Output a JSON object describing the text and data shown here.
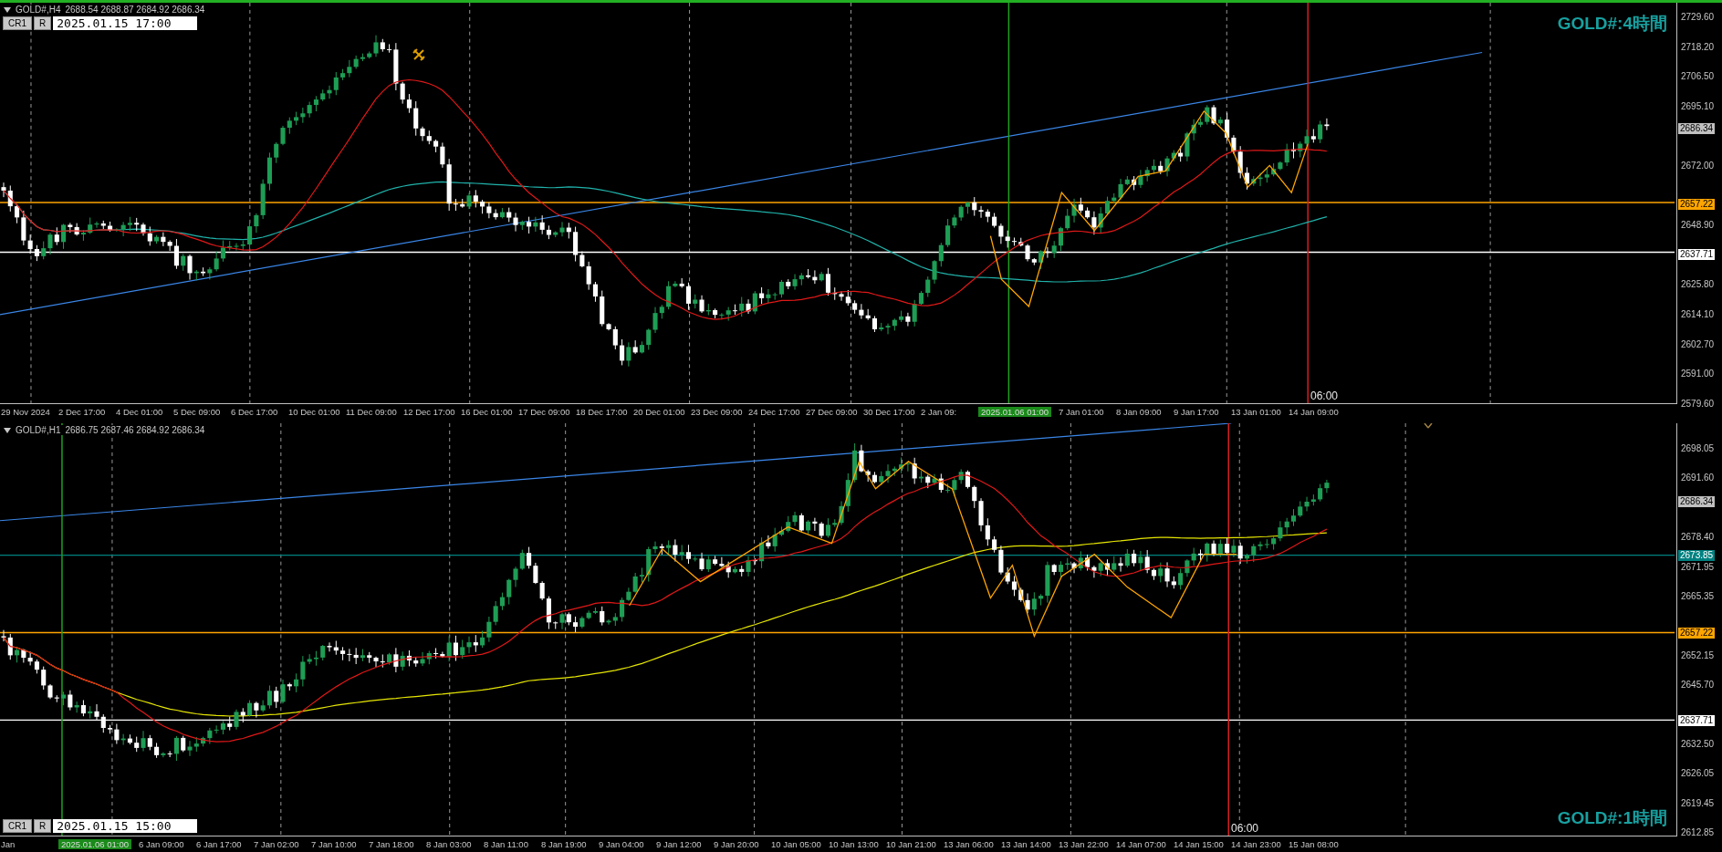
{
  "panels": [
    {
      "symbol": "GOLD#,H4",
      "ohlc": "2688.54 2688.87 2684.92 2686.34",
      "buttons": [
        "CR1",
        "R"
      ],
      "date_field": "2025.01.15 17:00",
      "title": "GOLD#:4時間",
      "cursor_time": "06:00",
      "price_ticks": [
        "2729.60",
        "2718.20",
        "2706.50",
        "2695.10",
        "2672.00",
        "2648.90",
        "2625.80",
        "2614.10",
        "2602.70",
        "2591.00",
        "2579.60"
      ],
      "price_markers": [
        {
          "text": "2686.34",
          "kind": "bid",
          "color": "#c0c0c0"
        },
        {
          "text": "2657.22",
          "kind": "line",
          "color": "#ffa500"
        },
        {
          "text": "2637.71",
          "kind": "line",
          "color": "#ffffff"
        }
      ],
      "time_labels": [
        {
          "text": "29 Nov 2024",
          "kind": "tick"
        },
        {
          "text": "2 Dec 17:00",
          "kind": "tick"
        },
        {
          "text": "4 Dec 01:00",
          "kind": "tick"
        },
        {
          "text": "5 Dec 09:00",
          "kind": "tick"
        },
        {
          "text": "6 Dec 17:00",
          "kind": "tick"
        },
        {
          "text": "10 Dec 01:00",
          "kind": "tick"
        },
        {
          "text": "11 Dec 09:00",
          "kind": "tick"
        },
        {
          "text": "12 Dec 17:00",
          "kind": "tick"
        },
        {
          "text": "16 Dec 01:00",
          "kind": "tick"
        },
        {
          "text": "17 Dec 09:00",
          "kind": "tick"
        },
        {
          "text": "18 Dec 17:00",
          "kind": "tick"
        },
        {
          "text": "20 Dec 01:00",
          "kind": "tick"
        },
        {
          "text": "23 Dec 09:00",
          "kind": "tick"
        },
        {
          "text": "24 Dec 17:00",
          "kind": "tick"
        },
        {
          "text": "27 Dec 09:00",
          "kind": "tick"
        },
        {
          "text": "30 Dec 17:00",
          "kind": "tick"
        },
        {
          "text": "2 Jan 09:",
          "kind": "tick"
        },
        {
          "text": "2025.01.06 01:00",
          "kind": "highlight"
        },
        {
          "text": "7 Jan 01:00",
          "kind": "tick"
        },
        {
          "text": "8 Jan 09:00",
          "kind": "tick"
        },
        {
          "text": "9 Jan 17:00",
          "kind": "tick"
        },
        {
          "text": "13 Jan 01:00",
          "kind": "tick"
        },
        {
          "text": "14 Jan 09:00",
          "kind": "tick"
        }
      ]
    },
    {
      "symbol": "GOLD#,H1",
      "ohlc": "2686.75 2687.46 2684.92 2686.34",
      "buttons": [
        "CR1",
        "R"
      ],
      "date_field": "2025.01.15 15:00",
      "title": "GOLD#:1時間",
      "cursor_time": "06:00",
      "price_ticks": [
        "2698.05",
        "2691.60",
        "2678.40",
        "2671.95",
        "2665.35",
        "2652.15",
        "2645.70",
        "2632.50",
        "2626.05",
        "2619.45",
        "2612.85"
      ],
      "price_markers": [
        {
          "text": "2686.34",
          "kind": "bid",
          "color": "#c0c0c0"
        },
        {
          "text": "2673.85",
          "kind": "line",
          "color": "#008080"
        },
        {
          "text": "2657.22",
          "kind": "line",
          "color": "#ffa500"
        },
        {
          "text": "2637.71",
          "kind": "line",
          "color": "#ffffff"
        }
      ],
      "time_labels": [
        {
          "text": "Jan",
          "kind": "tick"
        },
        {
          "text": "2025.01.06 01:00",
          "kind": "highlight"
        },
        {
          "text": "6 Jan 09:00",
          "kind": "tick"
        },
        {
          "text": "6 Jan 17:00",
          "kind": "tick"
        },
        {
          "text": "7 Jan 02:00",
          "kind": "tick"
        },
        {
          "text": "7 Jan 10:00",
          "kind": "tick"
        },
        {
          "text": "7 Jan 18:00",
          "kind": "tick"
        },
        {
          "text": "8 Jan 03:00",
          "kind": "tick"
        },
        {
          "text": "8 Jan 11:00",
          "kind": "tick"
        },
        {
          "text": "8 Jan 19:00",
          "kind": "tick"
        },
        {
          "text": "9 Jan 04:00",
          "kind": "tick"
        },
        {
          "text": "9 Jan 12:00",
          "kind": "tick"
        },
        {
          "text": "9 Jan 20:00",
          "kind": "tick"
        },
        {
          "text": "10 Jan 05:00",
          "kind": "tick"
        },
        {
          "text": "10 Jan 13:00",
          "kind": "tick"
        },
        {
          "text": "10 Jan 21:00",
          "kind": "tick"
        },
        {
          "text": "13 Jan 06:00",
          "kind": "tick"
        },
        {
          "text": "13 Jan 14:00",
          "kind": "tick"
        },
        {
          "text": "13 Jan 22:00",
          "kind": "tick"
        },
        {
          "text": "14 Jan 07:00",
          "kind": "tick"
        },
        {
          "text": "14 Jan 15:00",
          "kind": "tick"
        },
        {
          "text": "14 Jan 23:00",
          "kind": "tick"
        },
        {
          "text": "15 Jan 08:00",
          "kind": "tick"
        }
      ]
    }
  ]
}
